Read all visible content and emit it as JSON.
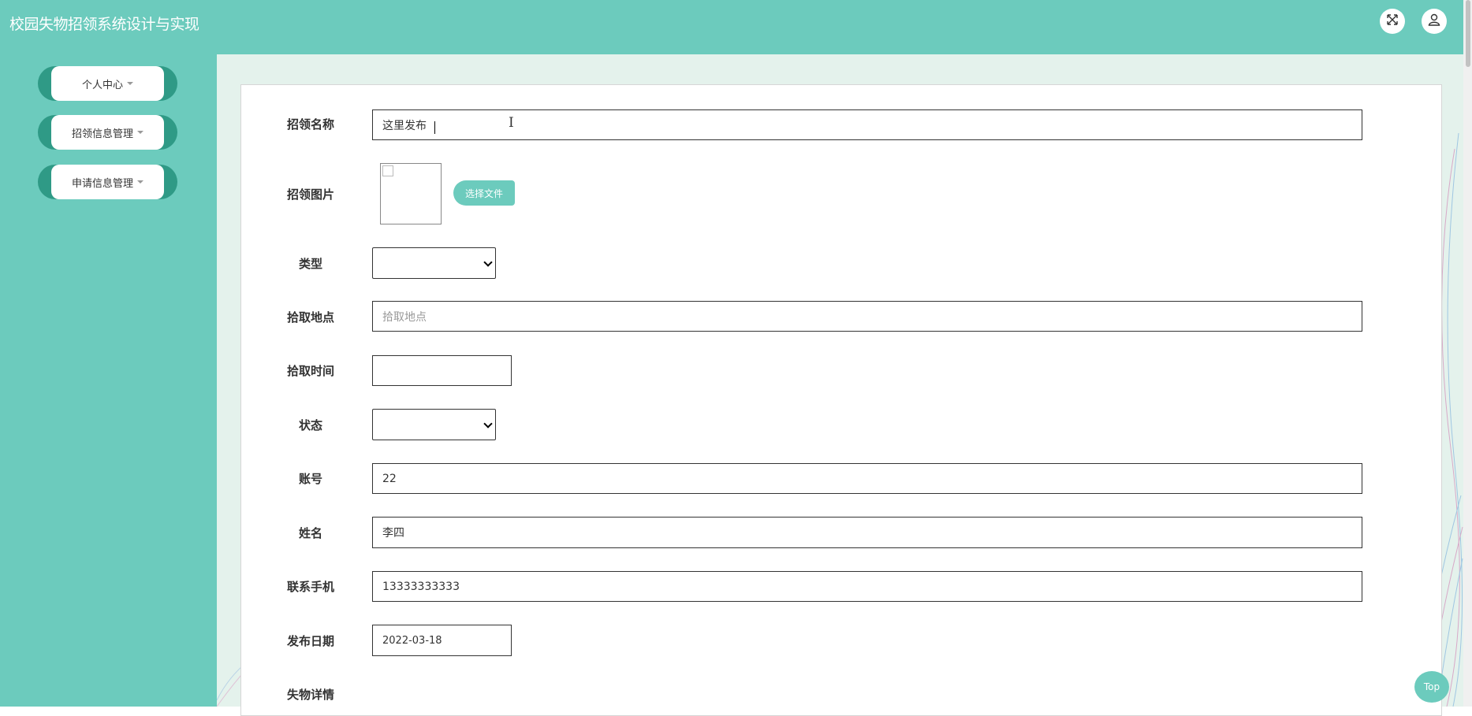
{
  "header": {
    "title": "校园失物招领系统设计与实现",
    "fullscreen_icon": "expand-arrows-icon",
    "user_icon": "user-icon"
  },
  "sidebar": {
    "items": [
      {
        "label": "个人中心"
      },
      {
        "label": "招领信息管理"
      },
      {
        "label": "申请信息管理"
      }
    ]
  },
  "form": {
    "fields": {
      "name": {
        "label": "招领名称",
        "value": "这里发布"
      },
      "image": {
        "label": "招领图片",
        "button": "选择文件"
      },
      "type": {
        "label": "类型",
        "value": ""
      },
      "location": {
        "label": "拾取地点",
        "placeholder": "拾取地点"
      },
      "pickup_time": {
        "label": "拾取时间",
        "value": ""
      },
      "status": {
        "label": "状态",
        "value": ""
      },
      "account": {
        "label": "账号",
        "value": "22"
      },
      "person_name": {
        "label": "姓名",
        "value": "李四"
      },
      "phone": {
        "label": "联系手机",
        "value": "13333333333"
      },
      "publish_date": {
        "label": "发布日期",
        "value": "2022-03-18"
      },
      "details": {
        "label": "失物详情"
      }
    }
  },
  "top_button": "Top",
  "colors": {
    "primary": "#6ccbbd",
    "sidebar_pill": "#2f9a86",
    "main_bg": "#e4f2ec"
  }
}
